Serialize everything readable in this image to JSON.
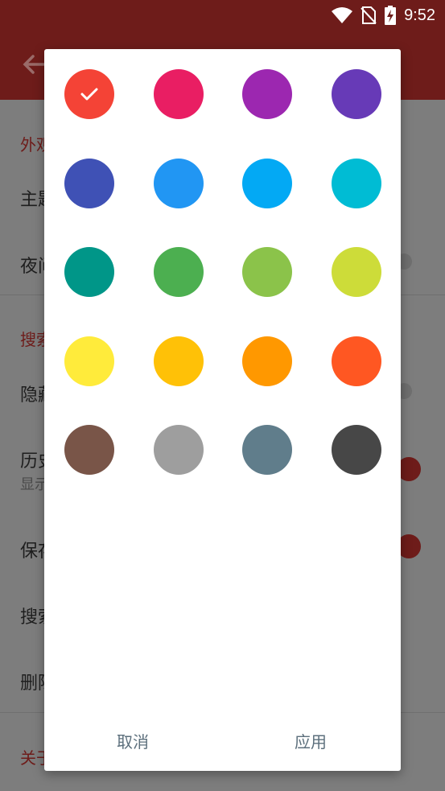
{
  "status_bar": {
    "time": "9:52"
  },
  "settings": {
    "section_appearance": "外观",
    "theme": "主题",
    "night": "夜间",
    "section_search": "搜索",
    "hide": "隐藏",
    "history": "历史",
    "history_sub": "显示",
    "save": "保存",
    "search": "搜索",
    "delete": "删除",
    "section_about": "关于"
  },
  "dialog": {
    "selected_color": "#f44336",
    "swatches": [
      {
        "name": "red",
        "color": "#f44336"
      },
      {
        "name": "pink",
        "color": "#e91e63"
      },
      {
        "name": "purple",
        "color": "#9c27b0"
      },
      {
        "name": "deep-purple",
        "color": "#673ab7"
      },
      {
        "name": "indigo",
        "color": "#3f51b5"
      },
      {
        "name": "blue",
        "color": "#2196f3"
      },
      {
        "name": "light-blue",
        "color": "#03a9f4"
      },
      {
        "name": "cyan",
        "color": "#00bcd4"
      },
      {
        "name": "teal",
        "color": "#009688"
      },
      {
        "name": "green",
        "color": "#4caf50"
      },
      {
        "name": "light-green",
        "color": "#8bc34a"
      },
      {
        "name": "lime",
        "color": "#cddc39"
      },
      {
        "name": "yellow",
        "color": "#ffeb3b"
      },
      {
        "name": "amber",
        "color": "#ffc107"
      },
      {
        "name": "orange",
        "color": "#ff9800"
      },
      {
        "name": "deep-orange",
        "color": "#ff5722"
      },
      {
        "name": "brown",
        "color": "#795548"
      },
      {
        "name": "grey",
        "color": "#9e9e9e"
      },
      {
        "name": "blue-grey",
        "color": "#607d8b"
      },
      {
        "name": "dark-grey",
        "color": "#474747"
      }
    ],
    "cancel_label": "取消",
    "apply_label": "应用"
  }
}
